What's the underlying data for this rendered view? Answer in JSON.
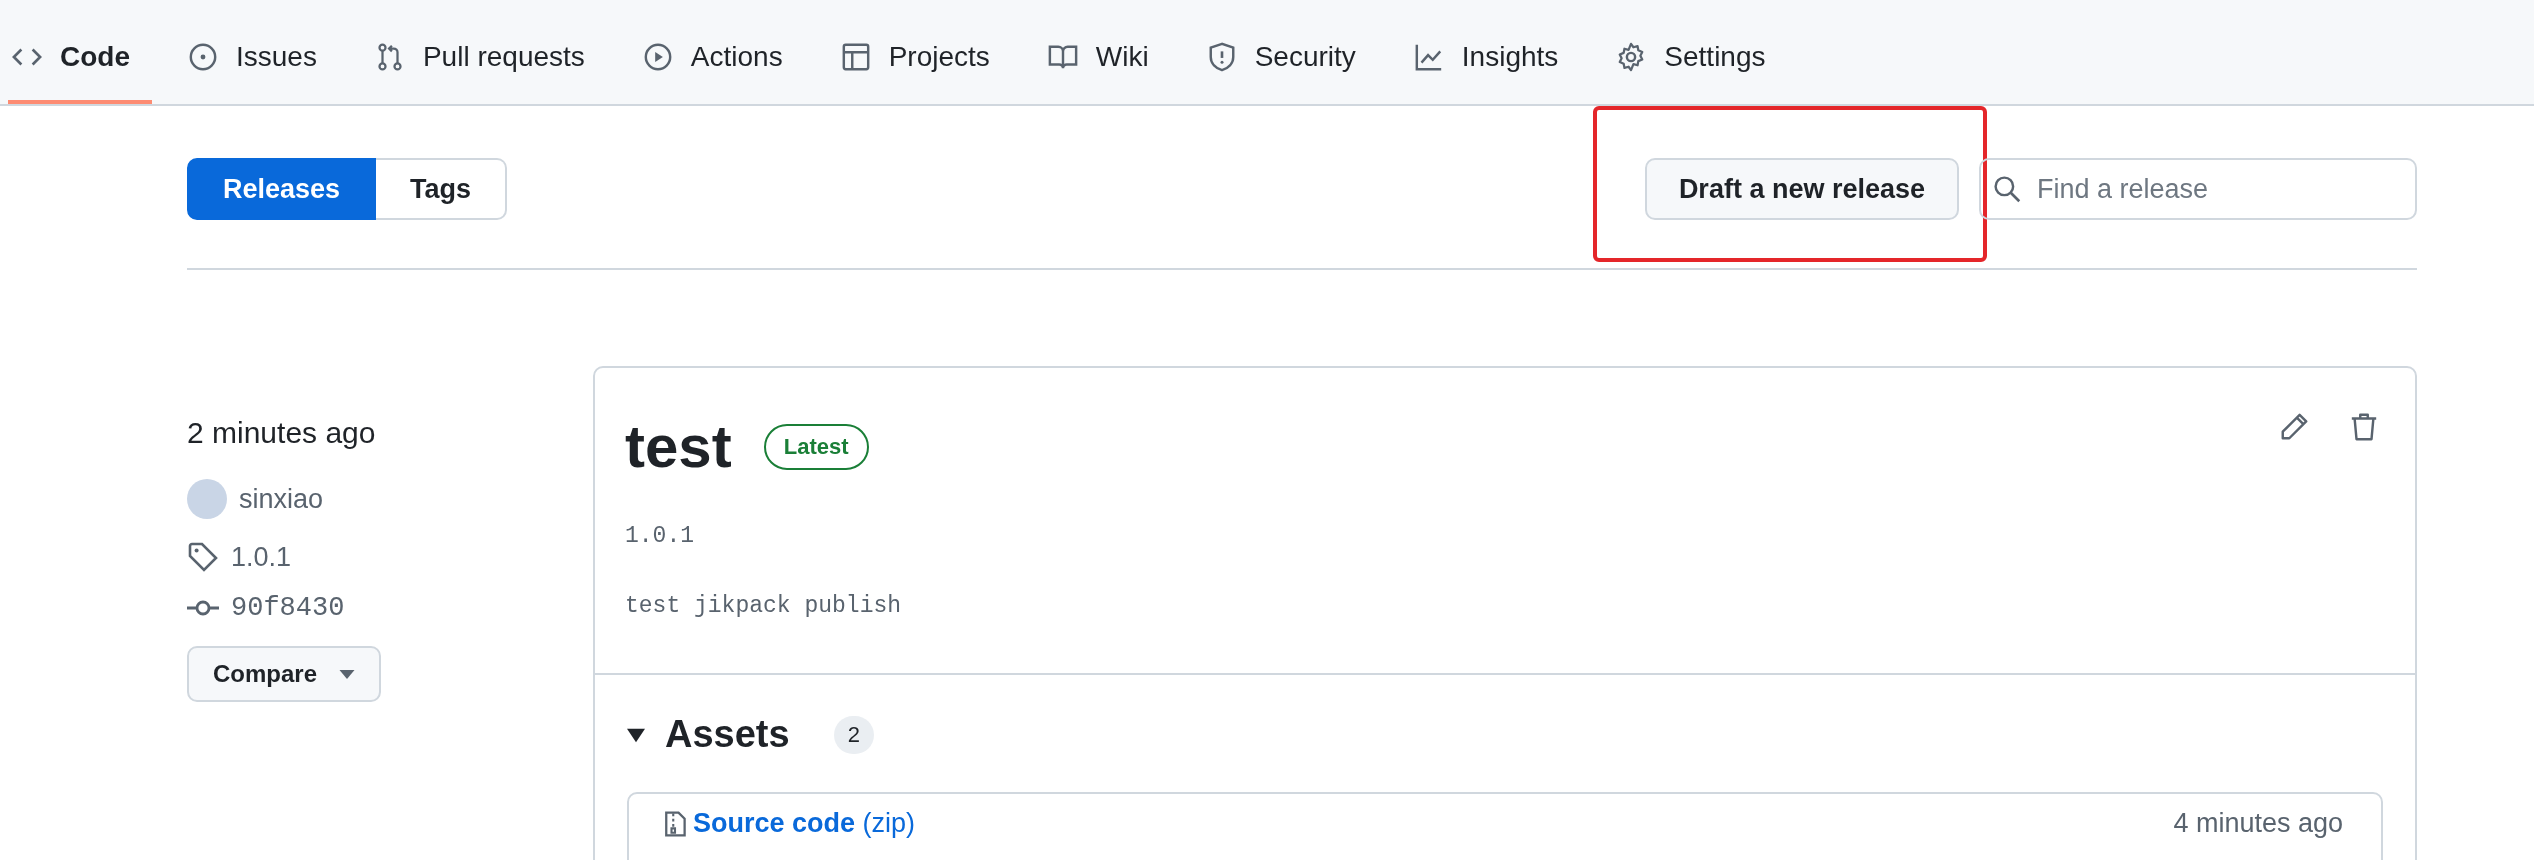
{
  "nav": {
    "tabs": [
      {
        "label": "Code",
        "kind": "code",
        "selected": true
      },
      {
        "label": "Issues",
        "kind": "issues",
        "selected": false
      },
      {
        "label": "Pull requests",
        "kind": "pull",
        "selected": false
      },
      {
        "label": "Actions",
        "kind": "actions",
        "selected": false
      },
      {
        "label": "Projects",
        "kind": "projects",
        "selected": false
      },
      {
        "label": "Wiki",
        "kind": "wiki",
        "selected": false
      },
      {
        "label": "Security",
        "kind": "security",
        "selected": false
      },
      {
        "label": "Insights",
        "kind": "insights",
        "selected": false
      },
      {
        "label": "Settings",
        "kind": "settings",
        "selected": false
      }
    ]
  },
  "toolbar": {
    "toggles": [
      {
        "label": "Releases",
        "selected": true
      },
      {
        "label": "Tags",
        "selected": false
      }
    ],
    "draft_button": "Draft a new release",
    "search": {
      "placeholder": "Find a release"
    }
  },
  "release": {
    "time": "2 minutes ago",
    "author": "sinxiao",
    "tag": "1.0.1",
    "commit": "90f8430",
    "compare_button": "Compare",
    "title": "test",
    "badge": "Latest",
    "body": [
      "1.0.1",
      "test jikpack publish"
    ],
    "assets": {
      "title": "Assets",
      "count": "2",
      "expanded": true,
      "items": [
        {
          "name": "Source code",
          "format": "(zip)",
          "time": "4 minutes ago"
        }
      ]
    }
  }
}
